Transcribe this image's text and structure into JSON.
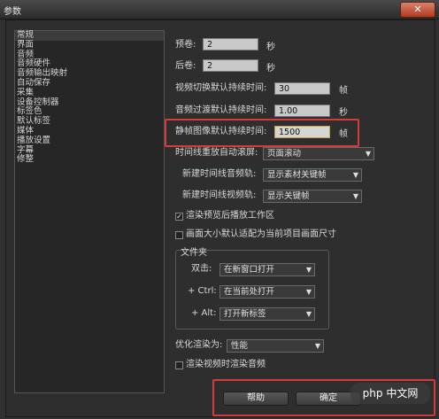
{
  "window": {
    "title": "参数"
  },
  "sidebar": {
    "items": [
      {
        "label": "常规"
      },
      {
        "label": "界面"
      },
      {
        "label": "音频"
      },
      {
        "label": "音频硬件"
      },
      {
        "label": "音频输出映射"
      },
      {
        "label": "自动保存"
      },
      {
        "label": "采集"
      },
      {
        "label": "设备控制器"
      },
      {
        "label": "标签色"
      },
      {
        "label": "默认标签"
      },
      {
        "label": "媒体"
      },
      {
        "label": "播放设置"
      },
      {
        "label": "字幕"
      },
      {
        "label": "修整"
      }
    ]
  },
  "general": {
    "preroll_label": "预卷:",
    "preroll_value": "2",
    "preroll_unit": "秒",
    "postroll_label": "后卷:",
    "postroll_value": "2",
    "postroll_unit": "秒",
    "video_transition_label": "视频切换默认持续时间:",
    "video_transition_value": "30",
    "video_transition_unit": "帧",
    "audio_transition_label": "音频过渡默认持续时间:",
    "audio_transition_value": "1.00",
    "audio_transition_unit": "秒",
    "still_image_label": "静帧图像默认持续时间:",
    "still_image_value": "1500",
    "still_image_unit": "帧",
    "timeline_scroll_label": "时间线重放自动滚屏:",
    "timeline_scroll_value": "页面滚动",
    "new_audio_track_label": "新建时间线音频轨:",
    "new_audio_track_value": "显示素材关键帧",
    "new_video_track_label": "新建时间线视频轨:",
    "new_video_track_value": "显示关键帧",
    "render_preview_label": "渲染预览后播放工作区",
    "render_preview_checked": true,
    "frame_size_label": "画面大小默认适配为当前项目画面尺寸",
    "frame_size_checked": false,
    "bins": {
      "title": "文件夹",
      "double_click_label": "双击:",
      "double_click_value": "在新窗口打开",
      "ctrl_label": "+ Ctrl:",
      "ctrl_value": "在当前处打开",
      "alt_label": "+ Alt:",
      "alt_value": "打开新标签"
    },
    "optimize_label": "优化渲染为:",
    "optimize_value": "性能",
    "render_audio_label": "渲染视频时渲染音频",
    "render_audio_checked": false
  },
  "footer": {
    "help_label": "帮助",
    "ok_label": "确定"
  },
  "watermark": "php 中文网",
  "colors": {
    "highlight": "#d43c3c",
    "background": "#303030"
  }
}
